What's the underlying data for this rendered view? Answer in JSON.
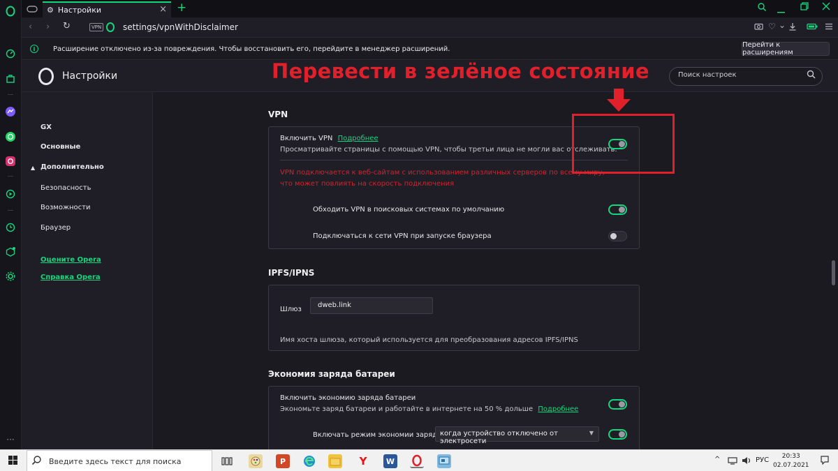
{
  "tab": {
    "title": "Настройки"
  },
  "address": {
    "vpn_badge": "VPN",
    "url": "settings/vpnWithDisclaimer"
  },
  "infobar": {
    "message": "Расширение отключено из-за повреждения. Чтобы восстановить его, перейдите в менеджер расширений.",
    "button": "Перейти к расширениям"
  },
  "header": {
    "title": "Настройки",
    "search_placeholder": "Поиск настроек",
    "annotation": "Перевести в зелёное состояние"
  },
  "nav": {
    "gx": "GX",
    "basic": "Основные",
    "advanced": "Дополнительно",
    "security": "Безопасность",
    "features": "Возможности",
    "browser": "Браузер",
    "rate": "Оцените Opera",
    "help": "Справка Opera"
  },
  "vpn": {
    "section": "VPN",
    "enable_label": "Включить VPN",
    "more": "Подробнее",
    "enable_desc": "Просматривайте страницы с помощью VPN, чтобы третьи лица не могли вас отслеживать.",
    "enable_on": true,
    "warning": "VPN подключается к веб-сайтам с использованием различных серверов по всему миру, что может повлиять на скорость подключения",
    "bypass_label": "Обходить VPN в поисковых системах по умолчанию",
    "bypass_on": true,
    "autostart_label": "Подключаться к сети VPN при запуске браузера",
    "autostart_on": false
  },
  "ipfs": {
    "section": "IPFS/IPNS",
    "gateway_label": "Шлюз",
    "gateway_value": "dweb.link",
    "desc": "Имя хоста шлюза, который используется для преобразования адресов IPFS/IPNS"
  },
  "battery": {
    "section": "Экономия заряда батареи",
    "enable_label": "Включить экономию заряда батареи",
    "enable_desc": "Экономьте заряд батареи и работайте в интернете на 50 % дольше",
    "more": "Подробнее",
    "enable_on": true,
    "mode_label": "Включать режим экономии заряда",
    "mode_value": "когда устройство отключено от электросети",
    "mode_on": true
  },
  "taskbar": {
    "search_placeholder": "Введите здесь текст для поиска",
    "lang": "РУС",
    "time": "20:33",
    "date": "02.07.2021"
  },
  "colors": {
    "accent": "#16d67d",
    "annotation": "#e0202b",
    "background": "#1b1a21"
  }
}
